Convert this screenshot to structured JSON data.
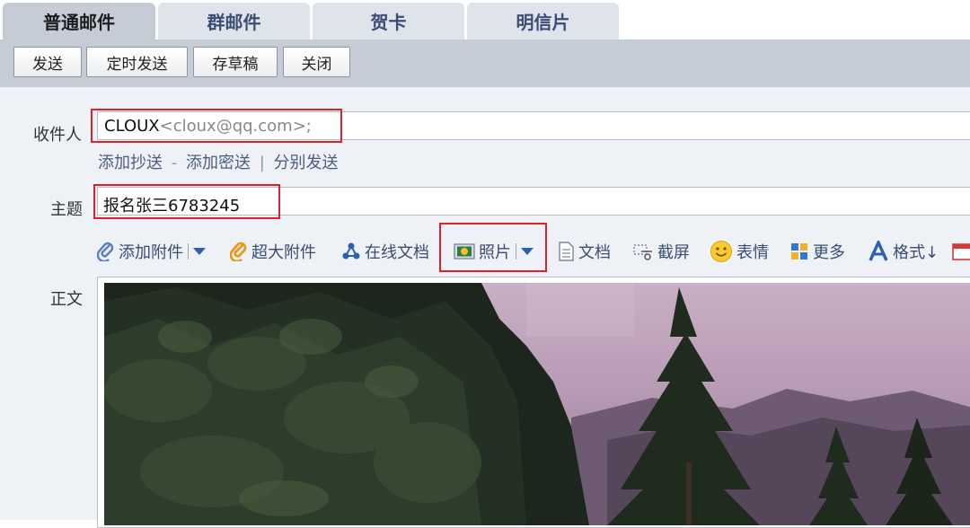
{
  "tabs": [
    {
      "label": "普通邮件",
      "active": true
    },
    {
      "label": "群邮件",
      "active": false
    },
    {
      "label": "贺卡",
      "active": false
    },
    {
      "label": "明信片",
      "active": false
    }
  ],
  "toolbar": {
    "send": "发送",
    "scheduled_send": "定时发送",
    "save_draft": "存草稿",
    "close": "关闭"
  },
  "recipient": {
    "label": "收件人",
    "name": "CLOUX",
    "email": "<cloux@qq.com>;"
  },
  "recipient_links": {
    "add_cc": "添加抄送",
    "dash": "-",
    "add_bcc": "添加密送",
    "bar": "|",
    "separate_send": "分别发送"
  },
  "subject": {
    "label": "主题",
    "value": "报名张三6783245"
  },
  "format_toolbar": {
    "add_attachment": "添加附件",
    "large_attachment": "超大附件",
    "online_document": "在线文档",
    "photo": "照片",
    "document": "文档",
    "screenshot": "截屏",
    "emoticon": "表情",
    "more": "更多",
    "format": "格式↓"
  },
  "body": {
    "label": "正文",
    "content": "photo of pine trees against pink sky and mountains"
  },
  "colors": {
    "highlight": "#d9222a",
    "toolbar_bg": "#c6ccd6",
    "link": "#4a5d82"
  }
}
